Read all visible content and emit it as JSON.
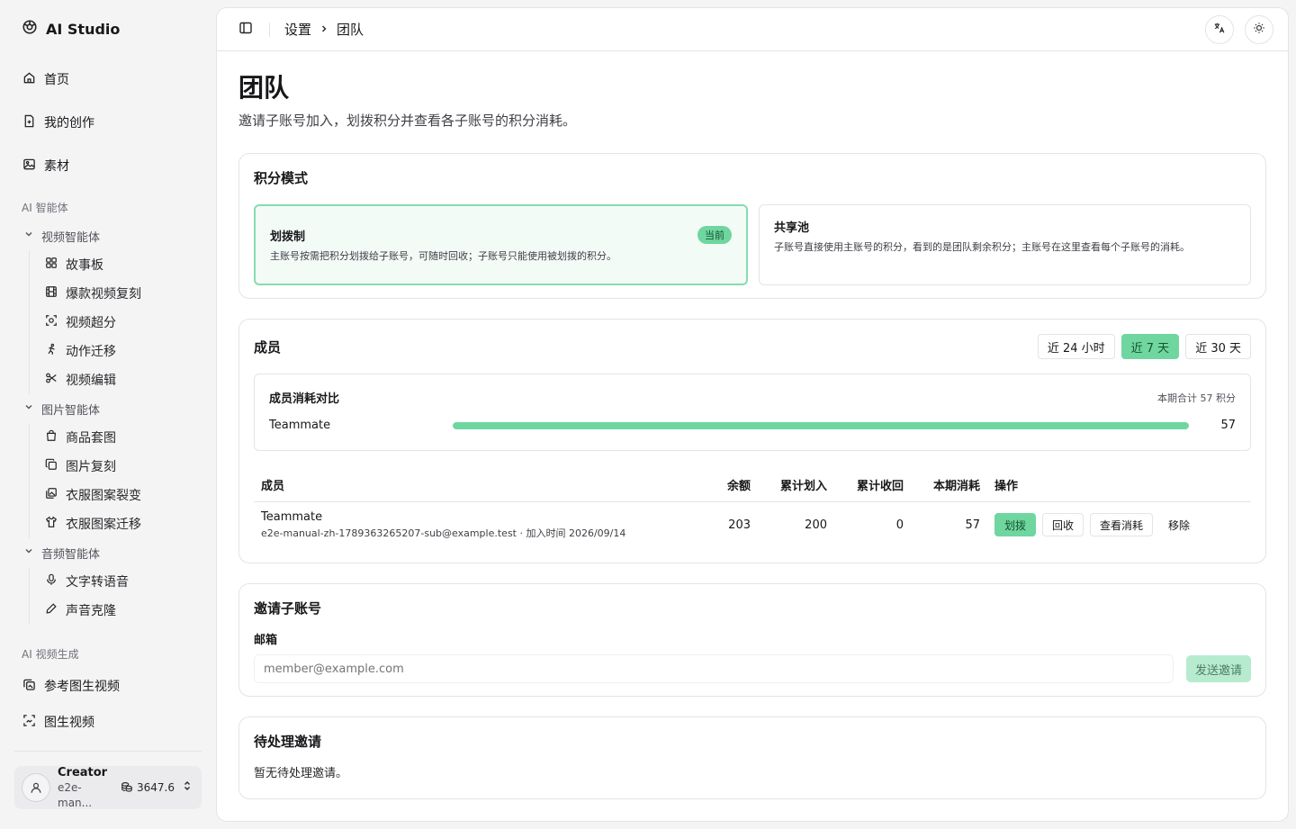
{
  "sidebar": {
    "brand": "AI Studio",
    "top_items": [
      {
        "label": "首页"
      },
      {
        "label": "我的创作"
      },
      {
        "label": "素材"
      }
    ],
    "section_agents": "AI 智能体",
    "groups": [
      {
        "label": "视频智能体",
        "items": [
          {
            "label": "故事板"
          },
          {
            "label": "爆款视频复刻"
          },
          {
            "label": "视频超分"
          },
          {
            "label": "动作迁移"
          },
          {
            "label": "视频编辑"
          }
        ]
      },
      {
        "label": "图片智能体",
        "items": [
          {
            "label": "商品套图"
          },
          {
            "label": "图片复刻"
          },
          {
            "label": "衣服图案裂变"
          },
          {
            "label": "衣服图案迁移"
          }
        ]
      },
      {
        "label": "音频智能体",
        "items": [
          {
            "label": "文字转语音"
          },
          {
            "label": "声音克隆"
          }
        ]
      }
    ],
    "section_video": "AI 视频生成",
    "video_items": [
      {
        "label": "参考图生视频"
      },
      {
        "label": "图生视频"
      }
    ],
    "user": {
      "name": "Creator",
      "email": "e2e-man...",
      "credits": "3647.6"
    }
  },
  "topbar": {
    "breadcrumb": [
      "设置",
      "团队"
    ]
  },
  "page": {
    "title": "团队",
    "description": "邀请子账号加入，划拨积分并查看各子账号的积分消耗。"
  },
  "credit_mode": {
    "title": "积分模式",
    "modes": [
      {
        "name": "划拨制",
        "badge": "当前",
        "desc": "主账号按需把积分划拨给子账号，可随时回收；子账号只能使用被划拨的积分。"
      },
      {
        "name": "共享池",
        "desc": "子账号直接使用主账号的积分，看到的是团队剩余积分；主账号在这里查看每个子账号的消耗。"
      }
    ]
  },
  "members": {
    "title": "成员",
    "ranges": [
      "近 24 小时",
      "近 7 天",
      "近 30 天"
    ],
    "active_range": 1,
    "compare": {
      "title": "成员消耗对比",
      "total": "本期合计 57 积分",
      "bars": [
        {
          "name": "Teammate",
          "value": 57,
          "fraction": 1.0
        }
      ]
    },
    "table": {
      "headers": [
        "成员",
        "余额",
        "累计划入",
        "累计收回",
        "本期消耗",
        "操作"
      ],
      "rows": [
        {
          "name": "Teammate",
          "sub": "e2e-manual-zh-1789363265207-sub@example.test · 加入时间 2026/09/14",
          "balance": "203",
          "allocated": "200",
          "reclaimed": "0",
          "consumed": "57",
          "actions": [
            "划拨",
            "回收",
            "查看消耗",
            "移除"
          ]
        }
      ]
    }
  },
  "invite": {
    "title": "邀请子账号",
    "email_label": "邮箱",
    "email_placeholder": "member@example.com",
    "send_label": "发送邀请"
  },
  "pending": {
    "title": "待处理邀请",
    "empty": "暂无待处理邀请。"
  },
  "colors": {
    "accent": "#6fd6a0",
    "accent_light": "#b7ebcf",
    "border": "#e4e4e7"
  }
}
